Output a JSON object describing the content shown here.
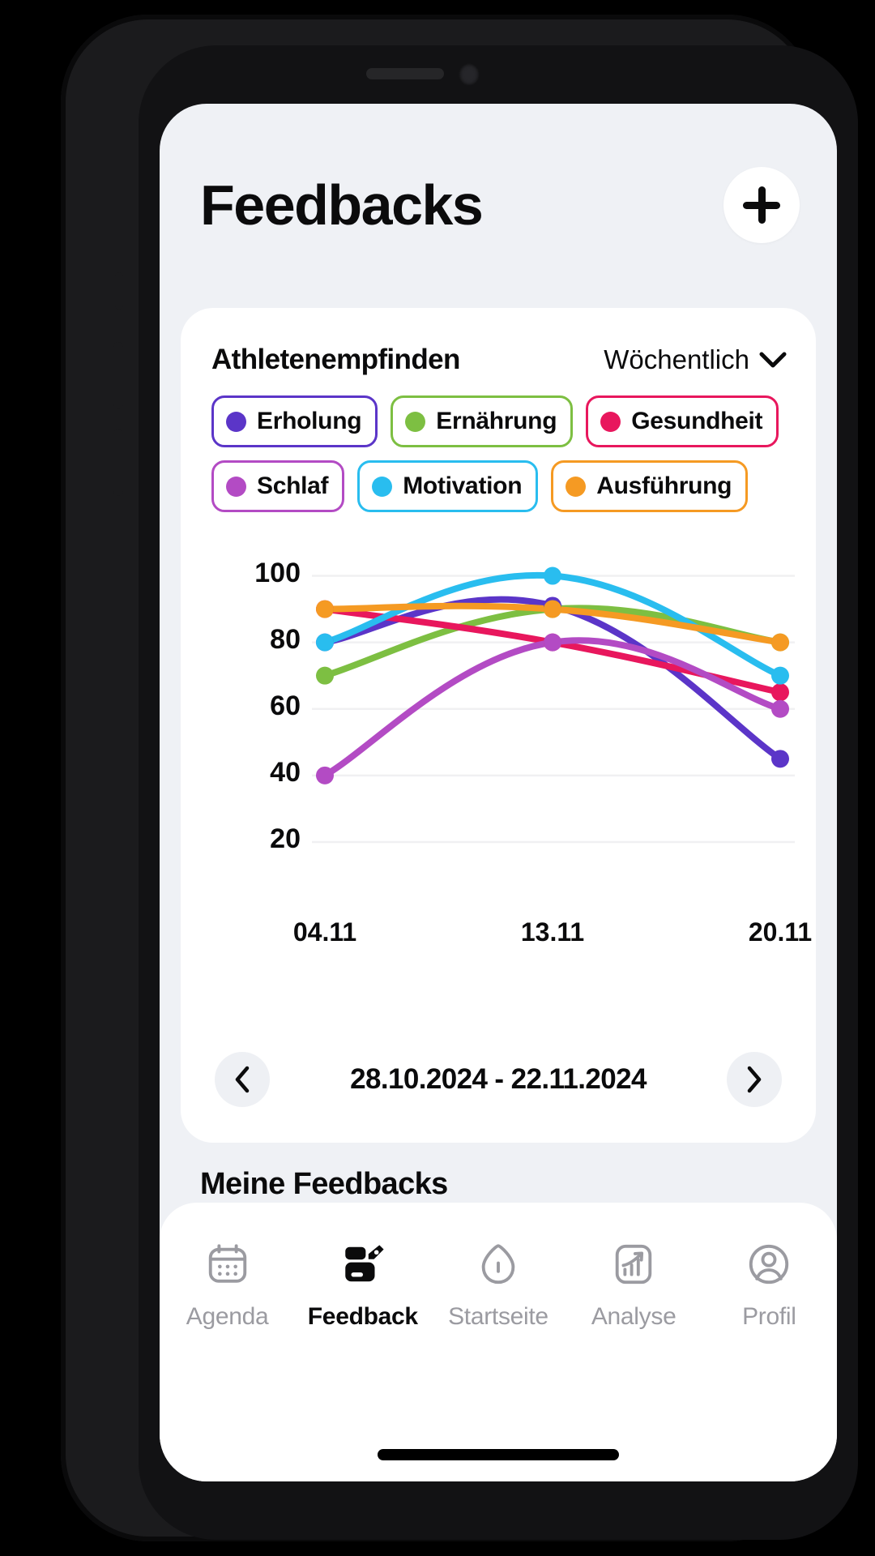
{
  "header": {
    "title": "Feedbacks",
    "add_button_icon": "plus-icon"
  },
  "chart_card": {
    "title": "Athletenempfinden",
    "period": {
      "selected": "Wöchentlich",
      "icon": "chevron-down-icon"
    },
    "legend": [
      {
        "label": "Erholung",
        "color": "#5B35C8"
      },
      {
        "label": "Ernährung",
        "color": "#7DBF42"
      },
      {
        "label": "Gesundheit",
        "color": "#E8175D"
      },
      {
        "label": "Schlaf",
        "color": "#B34BC4"
      },
      {
        "label": "Motivation",
        "color": "#29BDEF"
      },
      {
        "label": "Ausführung",
        "color": "#F59A23"
      }
    ],
    "range": {
      "label": "28.10.2024 - 22.11.2024",
      "prev_icon": "chevron-left-icon",
      "next_icon": "chevron-right-icon"
    }
  },
  "chart_data": {
    "type": "line",
    "title": "Athletenempfinden",
    "xlabel": "",
    "ylabel": "",
    "x": [
      "04.11",
      "13.11",
      "20.11"
    ],
    "categories": [
      "04.11",
      "13.11",
      "20.11"
    ],
    "ylim": [
      10,
      105
    ],
    "yticks": [
      100,
      80,
      60,
      40,
      20
    ],
    "grid": true,
    "legend_position": "top",
    "smoothing": "monotone-spline",
    "series": [
      {
        "name": "Erholung",
        "color": "#5B35C8",
        "values": [
          80,
          91,
          45
        ]
      },
      {
        "name": "Ernährung",
        "color": "#7DBF42",
        "values": [
          70,
          90,
          80
        ]
      },
      {
        "name": "Gesundheit",
        "color": "#E8175D",
        "values": [
          90,
          80,
          65
        ]
      },
      {
        "name": "Schlaf",
        "color": "#B34BC4",
        "values": [
          40,
          80,
          60
        ]
      },
      {
        "name": "Motivation",
        "color": "#29BDEF",
        "values": [
          80,
          100,
          70
        ]
      },
      {
        "name": "Ausführung",
        "color": "#F59A23",
        "values": [
          90,
          90,
          80
        ]
      }
    ]
  },
  "sections": {
    "my_feedbacks_title": "Meine Feedbacks"
  },
  "tab_bar": {
    "items": [
      {
        "label": "Agenda",
        "icon": "calendar-icon",
        "active": false
      },
      {
        "label": "Feedback",
        "icon": "feedback-card-icon",
        "active": true
      },
      {
        "label": "Startseite",
        "icon": "home-icon",
        "active": false
      },
      {
        "label": "Analyse",
        "icon": "analytics-chart-icon",
        "active": false
      },
      {
        "label": "Profil",
        "icon": "profile-person-icon",
        "active": false
      }
    ]
  },
  "colors": {
    "screen_background": "#eff1f5",
    "card_background": "#ffffff",
    "text_primary": "#0b0b0c",
    "text_muted": "#9b9ba1"
  }
}
